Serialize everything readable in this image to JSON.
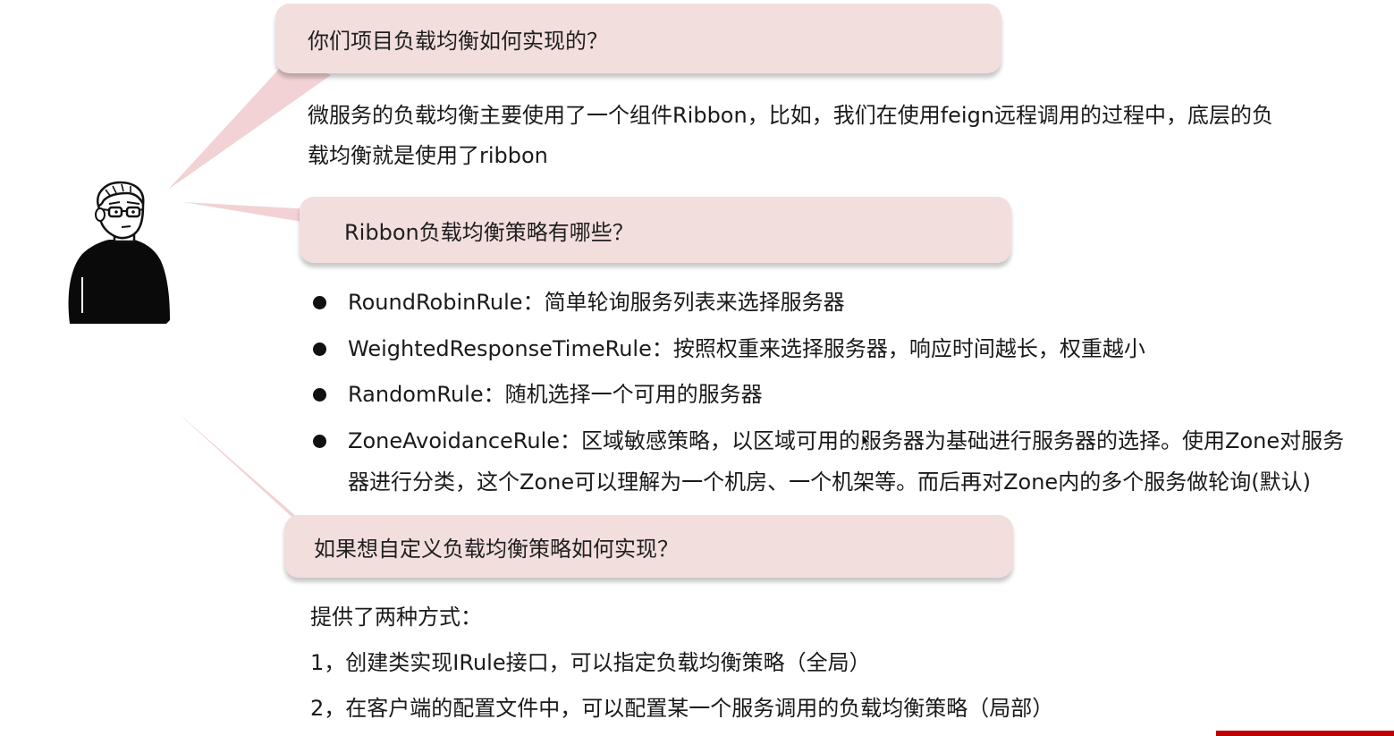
{
  "qa": [
    {
      "question": "你们项目负载均衡如何实现的？",
      "answer_lines": [
        "微服务的负载均衡主要使用了一个组件Ribbon，比如，我们在使用feign远程调用的过程中，底层的负",
        "载均衡就是使用了ribbon"
      ]
    },
    {
      "question": "Ribbon负载均衡策略有哪些？",
      "rules": [
        {
          "lines": [
            "RoundRobinRule：简单轮询服务列表来选择服务器"
          ]
        },
        {
          "lines": [
            "WeightedResponseTimeRule：按照权重来选择服务器，响应时间越长，权重越小"
          ]
        },
        {
          "lines": [
            "RandomRule：随机选择一个可用的服务器"
          ]
        },
        {
          "lines": [
            "ZoneAvoidanceRule：区域敏感策略，以区域可用的服务器为基础进行服务器的选择。使用Zone对服务",
            "器进行分类，这个Zone可以理解为一个机房、一个机架等。而后再对Zone内的多个服务做轮询(默认)"
          ]
        }
      ]
    },
    {
      "question": "如果想自定义负载均衡策略如何实现？",
      "intro": "提供了两种方式：",
      "methods": [
        "1，创建类实现IRule接口，可以指定负载均衡策略（全局）",
        "2，在客户端的配置文件中，可以配置某一个服务调用的负载均衡策略（局部）"
      ]
    }
  ],
  "icons": {
    "avatar": "person-with-glasses-icon",
    "cursor": "mouse-pointer-icon"
  },
  "colors": {
    "bubble": "#f3dede",
    "tail": "#f2d2d4",
    "accent_bar": "#c00000"
  }
}
